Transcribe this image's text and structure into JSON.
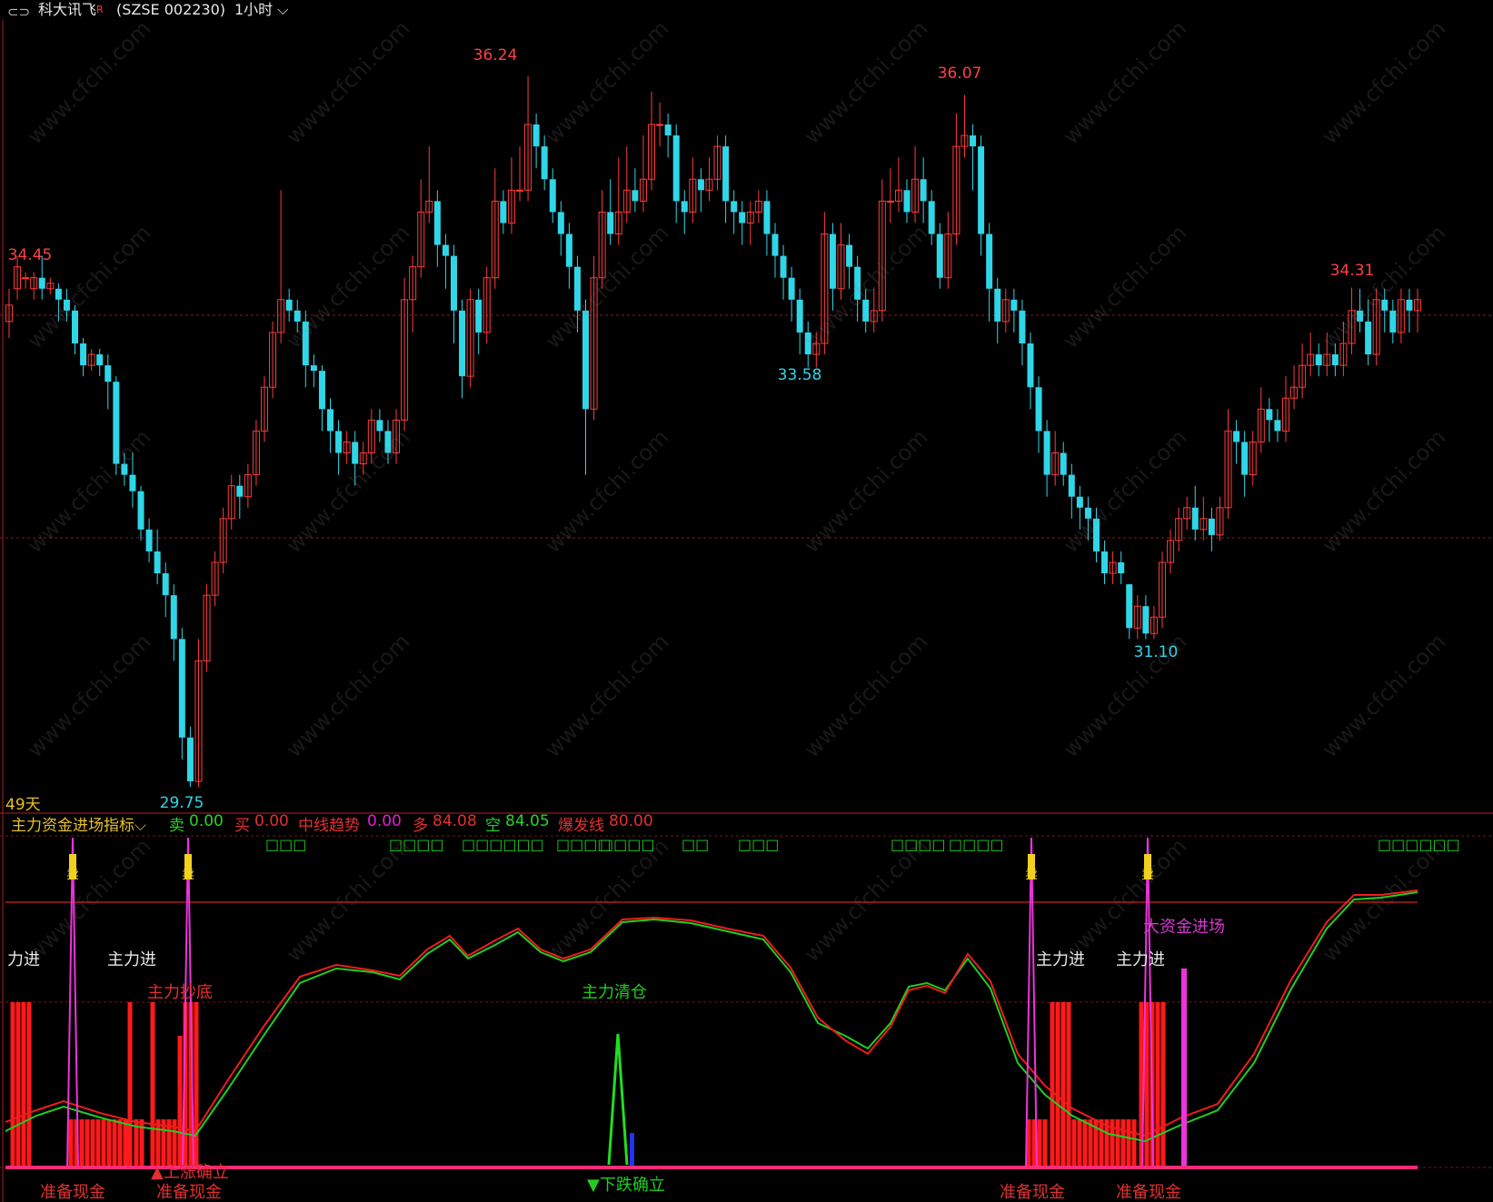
{
  "header": {
    "stock_name": "科大讯飞",
    "r_mark": "R",
    "stock_code": "(SZSE  002230)",
    "period": "1小时",
    "period_chevron": "chevron-down-icon",
    "link_icon": "link-icon"
  },
  "main_panel": {
    "days_label": "49天",
    "price_labels": [
      {
        "text": "36.24",
        "role": "high",
        "color": "#ff4040"
      },
      {
        "text": "36.07",
        "role": "high",
        "color": "#ff4040"
      },
      {
        "text": "34.45",
        "role": "high",
        "color": "#ff4040"
      },
      {
        "text": "34.31",
        "role": "high",
        "color": "#ff4040"
      },
      {
        "text": "33.58",
        "role": "low",
        "color": "#2fd6e8"
      },
      {
        "text": "31.10",
        "role": "low",
        "color": "#2fd6e8"
      },
      {
        "text": "29.75",
        "role": "low",
        "color": "#2fd6e8"
      }
    ]
  },
  "indicator": {
    "title": "主力资金进场指标",
    "sell_name": "卖",
    "sell_value": "0.00",
    "buy_name": "买",
    "buy_value": "0.00",
    "trend_name": "中线趋势",
    "trend_value": "0.00",
    "long_name": "多",
    "long_value": "84.08",
    "short_name": "空",
    "short_value": "84.05",
    "burst_name": "爆发线",
    "burst_value": "80.00",
    "annotations": {
      "main_in": "主力进",
      "main_in_partial": "力进",
      "bottom_grab": "主力抄底",
      "main_clear": "主力清仓",
      "big_fund": "大资金进场",
      "prepare_cash": "准备现金",
      "fall_confirmed": "▼下跌确立",
      "rise_confirmed": "▲上涨确立",
      "sell_char": "卖",
      "green_box": "□"
    }
  },
  "chart_data": {
    "type": "candlestick",
    "grid": "off",
    "price_label_values": {
      "highs": [
        36.24,
        36.07,
        34.45,
        34.31
      ],
      "lows": [
        33.58,
        31.1,
        29.75
      ]
    },
    "price_candles": [
      [
        34.0,
        34.15,
        34.3,
        33.85
      ],
      [
        34.3,
        34.5,
        34.6,
        34.2
      ],
      [
        34.4,
        34.4,
        34.45,
        34.3
      ],
      [
        34.3,
        34.4,
        34.45,
        34.2
      ],
      [
        34.4,
        34.3,
        34.6,
        34.2
      ],
      [
        34.3,
        34.35,
        34.4,
        34.25
      ],
      [
        34.3,
        34.2,
        34.35,
        34.0
      ],
      [
        34.2,
        34.1,
        34.3,
        34.0
      ],
      [
        34.1,
        33.8,
        34.15,
        33.7
      ],
      [
        33.8,
        33.6,
        33.85,
        33.5
      ],
      [
        33.6,
        33.7,
        33.75,
        33.55
      ],
      [
        33.7,
        33.6,
        33.75,
        33.5
      ],
      [
        33.6,
        33.45,
        33.7,
        33.2
      ],
      [
        33.45,
        32.7,
        33.5,
        32.6
      ],
      [
        32.7,
        32.6,
        32.8,
        32.5
      ],
      [
        32.6,
        32.45,
        32.8,
        32.3
      ],
      [
        32.45,
        32.1,
        32.5,
        32.0
      ],
      [
        32.1,
        31.9,
        32.2,
        31.8
      ],
      [
        31.9,
        31.7,
        32.1,
        31.6
      ],
      [
        31.7,
        31.5,
        31.8,
        31.3
      ],
      [
        31.5,
        31.1,
        31.6,
        30.9
      ],
      [
        31.1,
        30.2,
        31.2,
        30.0
      ],
      [
        30.2,
        29.8,
        30.3,
        29.75
      ],
      [
        29.8,
        30.9,
        31.1,
        29.75
      ],
      [
        30.9,
        31.5,
        31.6,
        30.8
      ],
      [
        31.5,
        31.8,
        31.9,
        31.4
      ],
      [
        31.8,
        32.2,
        32.3,
        31.7
      ],
      [
        32.2,
        32.5,
        32.6,
        32.1
      ],
      [
        32.5,
        32.4,
        32.6,
        32.2
      ],
      [
        32.4,
        32.6,
        32.7,
        32.3
      ],
      [
        32.6,
        33.0,
        33.1,
        32.5
      ],
      [
        33.0,
        33.4,
        33.5,
        32.9
      ],
      [
        33.4,
        33.9,
        34.0,
        33.3
      ],
      [
        33.9,
        34.2,
        35.2,
        33.8
      ],
      [
        34.2,
        34.1,
        34.3,
        34.0
      ],
      [
        34.1,
        34.0,
        34.2,
        33.9
      ],
      [
        34.0,
        33.6,
        34.1,
        33.4
      ],
      [
        33.6,
        33.55,
        33.7,
        33.4
      ],
      [
        33.55,
        33.2,
        33.6,
        33.0
      ],
      [
        33.2,
        33.0,
        33.3,
        32.8
      ],
      [
        33.0,
        32.8,
        33.1,
        32.6
      ],
      [
        32.8,
        32.9,
        33.0,
        32.7
      ],
      [
        32.9,
        32.7,
        33.0,
        32.5
      ],
      [
        32.7,
        32.8,
        32.9,
        32.6
      ],
      [
        32.8,
        33.1,
        33.2,
        32.7
      ],
      [
        33.1,
        33.0,
        33.2,
        32.9
      ],
      [
        33.0,
        32.8,
        33.1,
        32.7
      ],
      [
        32.8,
        33.1,
        33.2,
        32.7
      ],
      [
        33.1,
        34.2,
        34.4,
        33.0
      ],
      [
        34.2,
        34.5,
        34.6,
        33.9
      ],
      [
        34.5,
        35.0,
        35.3,
        34.4
      ],
      [
        35.0,
        35.1,
        35.6,
        34.9
      ],
      [
        35.1,
        34.7,
        35.2,
        34.5
      ],
      [
        34.7,
        34.6,
        34.8,
        34.3
      ],
      [
        34.6,
        34.1,
        34.7,
        33.8
      ],
      [
        34.1,
        33.5,
        34.2,
        33.3
      ],
      [
        33.5,
        34.2,
        34.3,
        33.4
      ],
      [
        34.2,
        33.9,
        34.3,
        33.7
      ],
      [
        33.9,
        34.4,
        34.5,
        33.8
      ],
      [
        34.4,
        35.1,
        35.4,
        34.3
      ],
      [
        35.1,
        34.9,
        35.2,
        34.8
      ],
      [
        34.9,
        35.2,
        35.5,
        34.8
      ],
      [
        35.2,
        35.2,
        35.6,
        35.1
      ],
      [
        35.2,
        35.8,
        36.24,
        35.1
      ],
      [
        35.8,
        35.6,
        35.9,
        35.4
      ],
      [
        35.6,
        35.3,
        35.7,
        35.2
      ],
      [
        35.3,
        35.0,
        35.4,
        34.9
      ],
      [
        35.0,
        34.8,
        35.1,
        34.6
      ],
      [
        34.8,
        34.5,
        34.9,
        34.3
      ],
      [
        34.5,
        34.1,
        34.6,
        33.9
      ],
      [
        34.1,
        33.2,
        34.2,
        32.6
      ],
      [
        33.2,
        34.4,
        34.6,
        33.1
      ],
      [
        34.4,
        35.0,
        35.2,
        34.3
      ],
      [
        35.0,
        34.8,
        35.3,
        34.7
      ],
      [
        34.8,
        35.0,
        35.5,
        34.7
      ],
      [
        35.0,
        35.2,
        35.6,
        34.9
      ],
      [
        35.2,
        35.1,
        35.4,
        35.0
      ],
      [
        35.1,
        35.3,
        35.7,
        35.0
      ],
      [
        35.3,
        35.8,
        36.1,
        35.2
      ],
      [
        35.8,
        35.8,
        36.0,
        35.6
      ],
      [
        35.8,
        35.7,
        35.9,
        35.5
      ],
      [
        35.7,
        35.1,
        35.8,
        34.9
      ],
      [
        35.1,
        35.0,
        35.2,
        34.8
      ],
      [
        35.0,
        35.3,
        35.5,
        34.9
      ],
      [
        35.3,
        35.2,
        35.4,
        35.0
      ],
      [
        35.2,
        35.3,
        35.5,
        35.1
      ],
      [
        35.3,
        35.6,
        35.7,
        35.2
      ],
      [
        35.6,
        35.1,
        35.7,
        34.9
      ],
      [
        35.1,
        35.0,
        35.2,
        34.8
      ],
      [
        35.0,
        34.9,
        35.1,
        34.7
      ],
      [
        34.9,
        35.0,
        35.1,
        34.7
      ],
      [
        35.0,
        35.1,
        35.2,
        34.9
      ],
      [
        35.1,
        34.8,
        35.2,
        34.6
      ],
      [
        34.8,
        34.6,
        34.9,
        34.4
      ],
      [
        34.6,
        34.4,
        34.7,
        34.2
      ],
      [
        34.4,
        34.2,
        34.5,
        34.0
      ],
      [
        34.2,
        33.9,
        34.3,
        33.7
      ],
      [
        33.9,
        33.7,
        34.0,
        33.58
      ],
      [
        33.7,
        33.8,
        33.9,
        33.58
      ],
      [
        33.8,
        34.8,
        35.0,
        33.7
      ],
      [
        34.8,
        34.3,
        34.9,
        34.1
      ],
      [
        34.3,
        34.7,
        34.9,
        34.2
      ],
      [
        34.7,
        34.5,
        34.8,
        34.3
      ],
      [
        34.5,
        34.2,
        34.6,
        34.0
      ],
      [
        34.2,
        34.0,
        34.3,
        33.9
      ],
      [
        34.0,
        34.1,
        34.3,
        33.9
      ],
      [
        34.1,
        35.1,
        35.3,
        34.0
      ],
      [
        35.1,
        35.1,
        35.4,
        34.9
      ],
      [
        35.1,
        35.2,
        35.5,
        35.0
      ],
      [
        35.2,
        35.0,
        35.3,
        34.9
      ],
      [
        35.0,
        35.3,
        35.6,
        34.9
      ],
      [
        35.3,
        35.1,
        35.5,
        34.9
      ],
      [
        35.1,
        34.8,
        35.2,
        34.7
      ],
      [
        34.8,
        34.4,
        34.9,
        34.3
      ],
      [
        34.4,
        34.8,
        35.0,
        34.3
      ],
      [
        34.8,
        35.6,
        35.9,
        34.7
      ],
      [
        35.6,
        35.7,
        36.07,
        35.5
      ],
      [
        35.7,
        35.6,
        35.8,
        35.2
      ],
      [
        35.6,
        34.8,
        35.7,
        34.6
      ],
      [
        34.8,
        34.3,
        34.9,
        34.0
      ],
      [
        34.3,
        34.0,
        34.4,
        33.8
      ],
      [
        34.0,
        34.2,
        34.3,
        33.9
      ],
      [
        34.2,
        34.1,
        34.3,
        33.9
      ],
      [
        34.1,
        33.8,
        34.2,
        33.6
      ],
      [
        33.8,
        33.4,
        33.9,
        33.2
      ],
      [
        33.4,
        33.0,
        33.5,
        32.8
      ],
      [
        33.0,
        32.6,
        33.1,
        32.4
      ],
      [
        32.6,
        32.8,
        33.0,
        32.5
      ],
      [
        32.8,
        32.6,
        32.9,
        32.5
      ],
      [
        32.6,
        32.4,
        32.7,
        32.2
      ],
      [
        32.4,
        32.3,
        32.5,
        32.1
      ],
      [
        32.3,
        32.2,
        32.4,
        32.0
      ],
      [
        32.2,
        31.9,
        32.3,
        31.8
      ],
      [
        31.9,
        31.7,
        32.0,
        31.6
      ],
      [
        31.7,
        31.8,
        31.9,
        31.6
      ],
      [
        31.8,
        31.7,
        31.9,
        31.6
      ],
      [
        31.6,
        31.2,
        31.6,
        31.1
      ],
      [
        31.2,
        31.4,
        31.5,
        31.1
      ],
      [
        31.4,
        31.15,
        31.5,
        31.1
      ],
      [
        31.15,
        31.3,
        31.4,
        31.1
      ],
      [
        31.3,
        31.8,
        31.9,
        31.2
      ],
      [
        31.8,
        32.0,
        32.1,
        31.7
      ],
      [
        32.0,
        32.2,
        32.3,
        31.9
      ],
      [
        32.2,
        32.3,
        32.4,
        32.1
      ],
      [
        32.3,
        32.1,
        32.5,
        32.0
      ],
      [
        32.1,
        32.2,
        32.4,
        32.0
      ],
      [
        32.2,
        32.05,
        32.3,
        31.9
      ],
      [
        32.05,
        32.3,
        32.4,
        32.0
      ],
      [
        32.3,
        33.0,
        33.2,
        32.2
      ],
      [
        33.0,
        32.9,
        33.1,
        32.7
      ],
      [
        32.9,
        32.6,
        33.0,
        32.4
      ],
      [
        32.6,
        32.9,
        33.0,
        32.5
      ],
      [
        32.9,
        33.2,
        33.4,
        32.8
      ],
      [
        33.2,
        33.1,
        33.3,
        32.9
      ],
      [
        33.1,
        33.0,
        33.2,
        32.9
      ],
      [
        33.0,
        33.3,
        33.5,
        32.9
      ],
      [
        33.3,
        33.4,
        33.6,
        33.2
      ],
      [
        33.4,
        33.6,
        33.8,
        33.3
      ],
      [
        33.6,
        33.7,
        33.9,
        33.5
      ],
      [
        33.7,
        33.6,
        33.8,
        33.5
      ],
      [
        33.6,
        33.7,
        33.9,
        33.5
      ],
      [
        33.7,
        33.6,
        33.8,
        33.5
      ],
      [
        33.6,
        33.8,
        34.0,
        33.5
      ],
      [
        33.8,
        34.1,
        34.31,
        33.7
      ],
      [
        34.1,
        34.0,
        34.3,
        33.9
      ],
      [
        34.0,
        33.7,
        34.2,
        33.6
      ],
      [
        33.7,
        34.2,
        34.3,
        33.6
      ],
      [
        34.2,
        34.1,
        34.3,
        33.9
      ],
      [
        34.1,
        33.9,
        34.2,
        33.8
      ],
      [
        33.9,
        34.2,
        34.3,
        33.8
      ],
      [
        34.2,
        34.1,
        34.3,
        33.9
      ],
      [
        34.1,
        34.2,
        34.3,
        33.9
      ]
    ],
    "indicator": {
      "burst_line": 80,
      "long_last": 84.08,
      "short_last": 84.05
    }
  }
}
